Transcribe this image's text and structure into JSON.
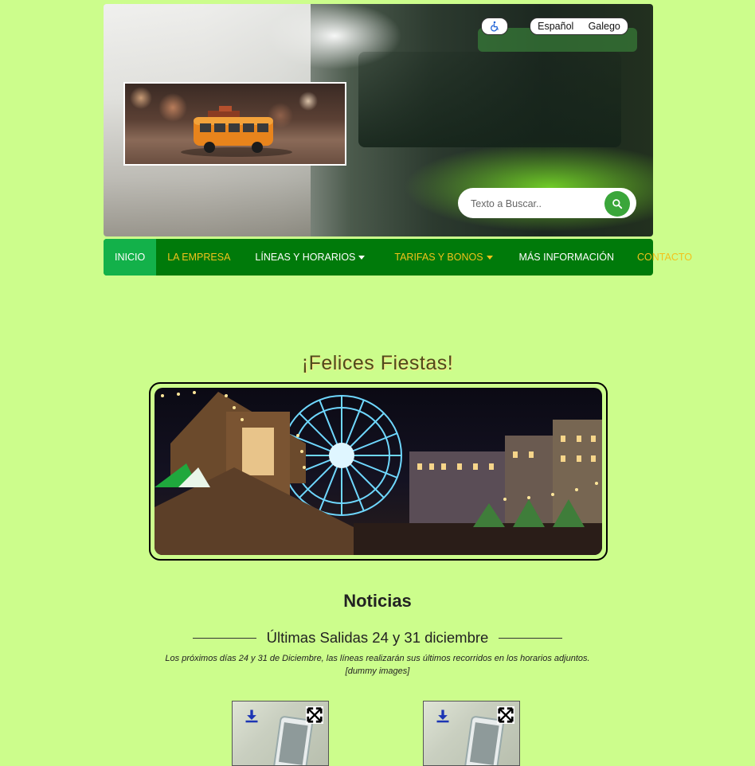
{
  "header": {
    "accessibility_icon": "wheelchair-icon",
    "languages": [
      "Español",
      "Galego"
    ],
    "search": {
      "placeholder": "Texto a Buscar..",
      "icon": "search-icon"
    }
  },
  "nav": {
    "items": [
      {
        "label": "INICIO",
        "active": true,
        "color": "white"
      },
      {
        "label": "LA EMPRESA",
        "color": "yellow"
      },
      {
        "label": "LÍNEAS Y HORARIOS",
        "dropdown": true,
        "color": "white"
      },
      {
        "label": "TARIFAS Y BONOS",
        "dropdown": true,
        "color": "yellow"
      },
      {
        "label": "MÁS INFORMACIÓN",
        "color": "white"
      },
      {
        "label": "CONTACTO",
        "color": "yellow"
      }
    ]
  },
  "fiestas": {
    "title": "¡Felices Fiestas!"
  },
  "news": {
    "heading": "Noticias",
    "item_title": "Últimas Salidas 24 y 31 diciembre",
    "item_text": "Los próximos días 24 y 31 de Diciembre, las líneas realizarán sus últimos recorridos en los horarios adjuntos.",
    "item_note": "[dummy images]",
    "attachment_icons": [
      "download-icon",
      "fullscreen-icon"
    ]
  },
  "colors": {
    "page_bg": "#ccfd8c",
    "nav_bg": "#007a0a",
    "nav_active": "#13b14a",
    "nav_yellow": "#f2c21b",
    "search_button": "#3aa63a"
  }
}
